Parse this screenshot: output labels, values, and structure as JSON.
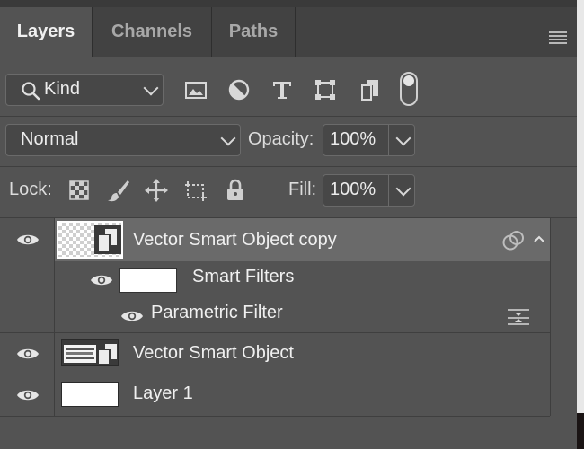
{
  "tabs": [
    {
      "label": "Layers",
      "active": true
    },
    {
      "label": "Channels",
      "active": false
    },
    {
      "label": "Paths",
      "active": false
    }
  ],
  "filter": {
    "kind_label": "Kind",
    "icons": [
      "image-filter-icon",
      "adjustment-filter-icon",
      "type-filter-icon",
      "shape-filter-icon",
      "smart-object-filter-icon"
    ]
  },
  "blend": {
    "mode": "Normal",
    "opacity_label": "Opacity:",
    "opacity_value": "100%"
  },
  "lock": {
    "label": "Lock:",
    "fill_label": "Fill:",
    "fill_value": "100%"
  },
  "layers": [
    {
      "name": "Vector Smart Object copy",
      "selected": true,
      "smart_filters_label": "Smart Filters",
      "filter_name": "Parametric Filter"
    },
    {
      "name": "Vector Smart Object",
      "selected": false
    },
    {
      "name": "Layer 1",
      "selected": false
    }
  ],
  "colors": {
    "panel_bg": "#535353",
    "selected_row": "#6a6a6a",
    "tab_bar": "#424242"
  }
}
